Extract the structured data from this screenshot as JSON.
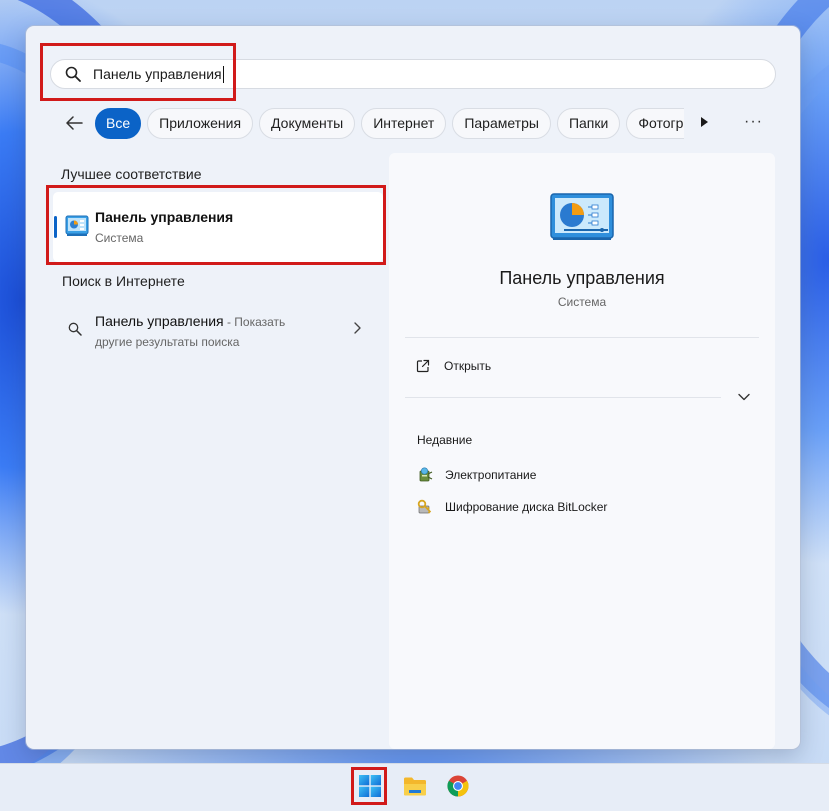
{
  "search": {
    "query": "Панель управления"
  },
  "filters": {
    "back_icon": "back-arrow-icon",
    "chips": [
      {
        "label": "Все",
        "active": true
      },
      {
        "label": "Приложения"
      },
      {
        "label": "Документы"
      },
      {
        "label": "Интернет"
      },
      {
        "label": "Параметры"
      },
      {
        "label": "Папки"
      },
      {
        "label": "Фотогр"
      }
    ],
    "more_label": "···"
  },
  "best_match": {
    "section_title": "Лучшее соответствие",
    "name": "Панель управления",
    "type": "Система",
    "icon": "control-panel-icon"
  },
  "web_search": {
    "section_title": "Поиск в Интернете",
    "query": "Панель управления",
    "suffix": " - Показать",
    "line2": "другие результаты поиска"
  },
  "preview": {
    "title": "Панель управления",
    "subtitle": "Система",
    "open_label": "Открыть",
    "recent_title": "Недавние",
    "recent": [
      {
        "label": "Электропитание",
        "icon": "power-options-icon"
      },
      {
        "label": "Шифрование диска BitLocker",
        "icon": "bitlocker-icon"
      }
    ]
  },
  "taskbar": {
    "items": [
      "windows-start-icon",
      "file-explorer-icon",
      "chrome-icon"
    ]
  },
  "colors": {
    "accent": "#0b63c7",
    "highlight_box": "#d11a1a"
  }
}
